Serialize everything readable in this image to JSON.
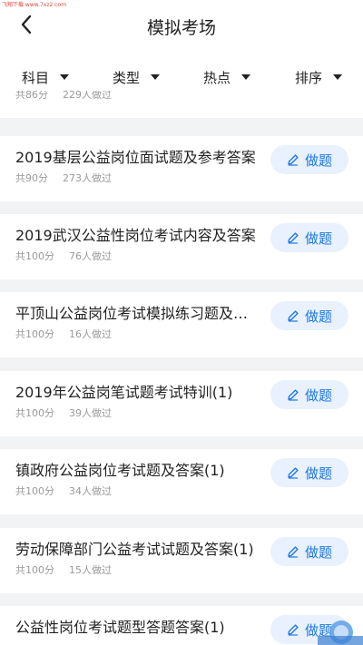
{
  "watermark": "飞翔下载 www.7xz2.com",
  "header": {
    "title": "模拟考场",
    "back_icon": "chevron-left-icon"
  },
  "filters": [
    {
      "label": "科目",
      "icon": "caret-down-icon"
    },
    {
      "label": "类型",
      "icon": "caret-down-icon"
    },
    {
      "label": "热点",
      "icon": "caret-down-icon"
    },
    {
      "label": "排序",
      "icon": "caret-down-icon"
    }
  ],
  "button_label": "做题",
  "button_icon": "pencil-icon",
  "items": [
    {
      "title": "",
      "score": "共86分",
      "count": "229人做过"
    },
    {
      "title": "2019基层公益岗位面试题及参考答案",
      "score": "共90分",
      "count": "273人做过"
    },
    {
      "title": "2019武汉公益性岗位考试内容及答案",
      "score": "共100分",
      "count": "76人做过"
    },
    {
      "title": "平顶山公益岗位考试模拟练习题及答案",
      "score": "共100分",
      "count": "16人做过"
    },
    {
      "title": "2019年公益岗笔试题考试特训(1)",
      "score": "共100分",
      "count": "39人做过"
    },
    {
      "title": "镇政府公益岗位考试题及答案(1)",
      "score": "共100分",
      "count": "34人做过"
    },
    {
      "title": "劳动保障部门公益考试试题及答案(1)",
      "score": "共100分",
      "count": "15人做过"
    },
    {
      "title": "公益性岗位考试题型答题答案(1)",
      "score": "",
      "count": ""
    }
  ],
  "colors": {
    "accent": "#1f78e6",
    "button_bg": "#e8f1fd",
    "page_bg": "#f2f3f5"
  }
}
